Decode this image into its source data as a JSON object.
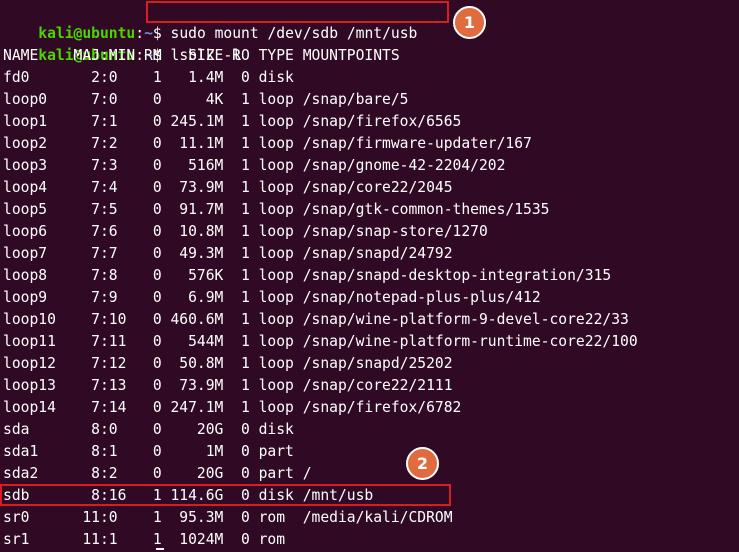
{
  "terminal": {
    "prompt": {
      "user_host": "kali@ubuntu",
      "separator": ":",
      "path": "~",
      "symbol": "$ "
    },
    "commands": [
      "sudo mount /dev/sdb /mnt/usb",
      "lsblk -l"
    ],
    "output": [
      "NAME    MAJ:MIN RM   SIZE RO TYPE MOUNTPOINTS",
      "fd0       2:0    1   1.4M  0 disk",
      "loop0     7:0    0     4K  1 loop /snap/bare/5",
      "loop1     7:1    0 245.1M  1 loop /snap/firefox/6565",
      "loop2     7:2    0  11.1M  1 loop /snap/firmware-updater/167",
      "loop3     7:3    0   516M  1 loop /snap/gnome-42-2204/202",
      "loop4     7:4    0  73.9M  1 loop /snap/core22/2045",
      "loop5     7:5    0  91.7M  1 loop /snap/gtk-common-themes/1535",
      "loop6     7:6    0  10.8M  1 loop /snap/snap-store/1270",
      "loop7     7:7    0  49.3M  1 loop /snap/snapd/24792",
      "loop8     7:8    0   576K  1 loop /snap/snapd-desktop-integration/315",
      "loop9     7:9    0   6.9M  1 loop /snap/notepad-plus-plus/412",
      "loop10    7:10   0 460.6M  1 loop /snap/wine-platform-9-devel-core22/33",
      "loop11    7:11   0   544M  1 loop /snap/wine-platform-runtime-core22/100",
      "loop12    7:12   0  50.8M  1 loop /snap/snapd/25202",
      "loop13    7:13   0  73.9M  1 loop /snap/core22/2111",
      "loop14    7:14   0 247.1M  1 loop /snap/firefox/6782",
      "sda       8:0    0    20G  0 disk",
      "sda1      8:1    0     1M  0 part",
      "sda2      8:2    0    20G  0 part /",
      "sdb       8:16   1 114.6G  0 disk /mnt/usb",
      "sr0      11:0    1  95.3M  0 rom  /media/kali/CDROM",
      "sr1      11:1    1  1024M  0 rom"
    ]
  },
  "annotations": {
    "badge_1": "1",
    "badge_2": "2"
  },
  "colors": {
    "background": "#300a24",
    "prompt_user": "#4bd600",
    "prompt_path": "#6f8fd8",
    "highlight": "#d91c22",
    "badge": "#e06b3e"
  }
}
